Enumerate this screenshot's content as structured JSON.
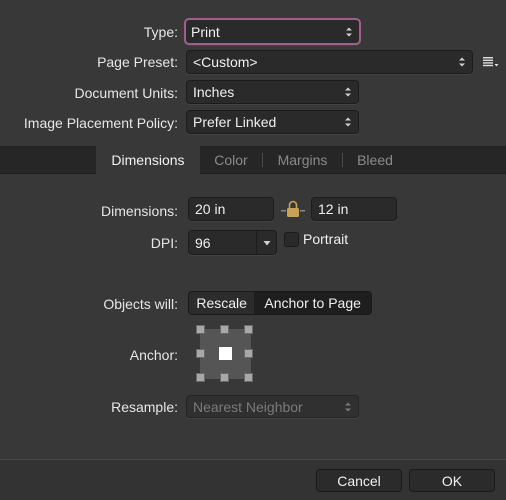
{
  "form": {
    "type": {
      "label": "Type:",
      "value": "Print"
    },
    "page_preset": {
      "label": "Page Preset:",
      "value": "<Custom>"
    },
    "document_units": {
      "label": "Document Units:",
      "value": "Inches"
    },
    "image_placement": {
      "label": "Image Placement Policy:",
      "value": "Prefer Linked"
    }
  },
  "tabs": [
    {
      "label": "Dimensions",
      "active": true
    },
    {
      "label": "Color",
      "active": false
    },
    {
      "label": "Margins",
      "active": false
    },
    {
      "label": "Bleed",
      "active": false
    }
  ],
  "dimensions": {
    "label": "Dimensions:",
    "width": "20 in",
    "height": "12 in",
    "dpi_label": "DPI:",
    "dpi": "96",
    "portrait_label": "Portrait",
    "portrait_checked": false
  },
  "objects": {
    "label": "Objects will:",
    "options": [
      "Rescale",
      "Anchor to Page"
    ],
    "selected": "Rescale"
  },
  "anchor": {
    "label": "Anchor:",
    "selected": "center"
  },
  "resample": {
    "label": "Resample:",
    "value": "Nearest Neighbor",
    "disabled": true
  },
  "buttons": {
    "cancel": "Cancel",
    "ok": "OK"
  },
  "colors": {
    "focus_ring": "#a0608f",
    "lock": "#c9a25a"
  }
}
